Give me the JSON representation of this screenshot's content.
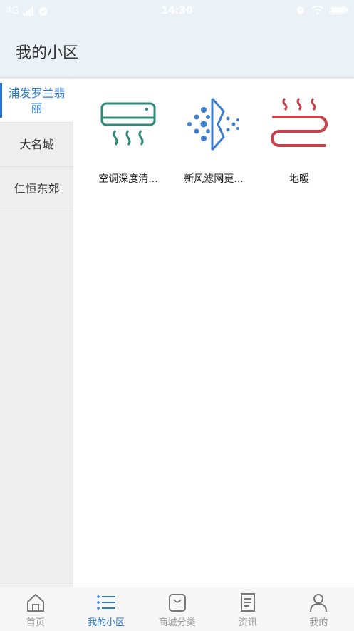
{
  "status_bar": {
    "network": "4G",
    "time": "14:30"
  },
  "header": {
    "title": "我的小区"
  },
  "sidebar": {
    "items": [
      {
        "label": "浦发罗兰翡丽",
        "active": true
      },
      {
        "label": "大名城",
        "active": false
      },
      {
        "label": "仁恒东郊",
        "active": false
      }
    ]
  },
  "services": [
    {
      "label": "空调深度清...",
      "icon": "air-conditioner-icon",
      "color": "#2e8b7a"
    },
    {
      "label": "新风滤网更...",
      "icon": "air-filter-icon",
      "color": "#3f7fd1"
    },
    {
      "label": "地暖",
      "icon": "floor-heating-icon",
      "color": "#c8414b"
    }
  ],
  "tabbar": {
    "tabs": [
      {
        "label": "首页",
        "icon": "home-icon",
        "active": false
      },
      {
        "label": "我的小区",
        "icon": "list-icon",
        "active": true
      },
      {
        "label": "商城分类",
        "icon": "shopping-bag-icon",
        "active": false
      },
      {
        "label": "资讯",
        "icon": "news-icon",
        "active": false
      },
      {
        "label": "我的",
        "icon": "user-icon",
        "active": false
      }
    ]
  },
  "colors": {
    "accent": "#2b7bd8",
    "header_bg": "#eaf1f7",
    "sidebar_bg": "#eeeeee",
    "inactive_tab": "#999999"
  }
}
